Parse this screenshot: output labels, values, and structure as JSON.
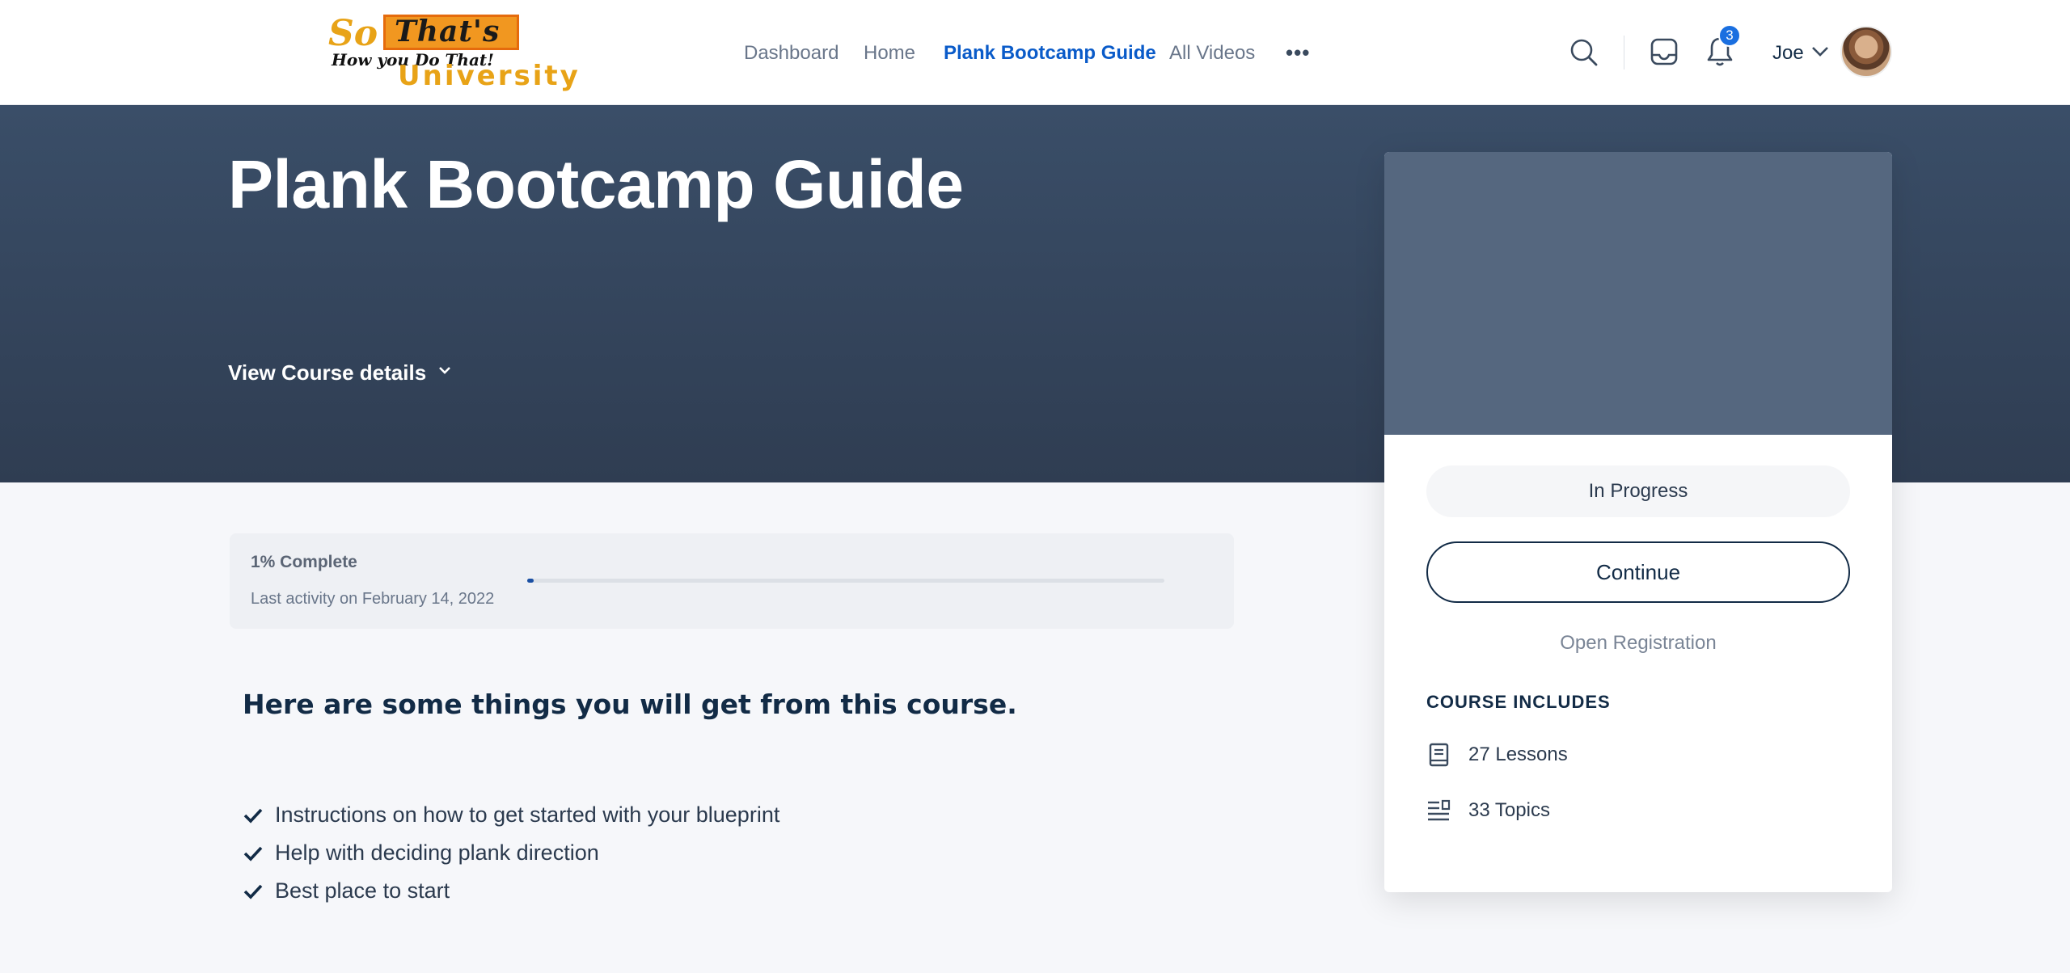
{
  "logo": {
    "line1_a": "So",
    "line1_b": "That's",
    "line2": "How you Do That!",
    "line3": "University"
  },
  "nav": {
    "items": [
      {
        "label": "Dashboard",
        "active": false
      },
      {
        "label": "Home",
        "active": false
      },
      {
        "label": "Plank Bootcamp Guide",
        "active": true
      },
      {
        "label": "All Videos",
        "active": false
      }
    ],
    "more": "•••"
  },
  "header": {
    "notification_count": "3",
    "user_name": "Joe"
  },
  "hero": {
    "title": "Plank Bootcamp Guide",
    "details_label": "View Course details"
  },
  "progress": {
    "percent_label": "1% Complete",
    "percent_value": 1,
    "last_activity": "Last activity on February 14, 2022"
  },
  "content": {
    "section_title": "Here are some things you will get from this course.",
    "benefits": [
      "Instructions on how to get started with your blueprint",
      "Help with deciding plank direction",
      "Best place to start"
    ]
  },
  "card": {
    "status": "In Progress",
    "continue_label": "Continue",
    "open_registration": "Open Registration",
    "includes_title": "COURSE INCLUDES",
    "lessons": "27 Lessons",
    "topics": "33 Topics"
  },
  "colors": {
    "accent": "#0a5bc9",
    "hero_bg": "#34465d",
    "badge": "#1a6fe0",
    "progress_fill": "#1a4fa3"
  }
}
